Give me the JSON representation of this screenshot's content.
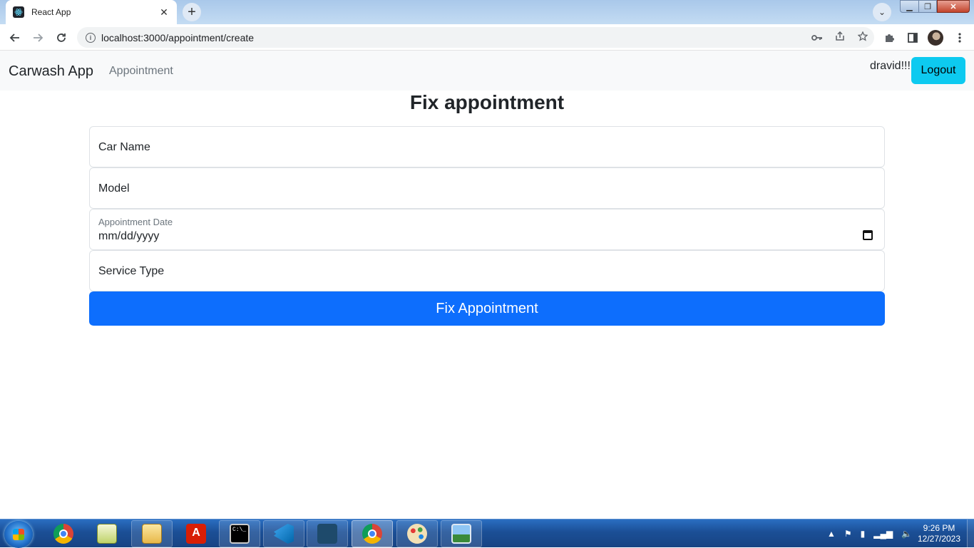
{
  "browser": {
    "tab_title": "React App",
    "tab_close": "✕",
    "new_tab": "+",
    "tab_search": "⌄",
    "url": "localhost:3000/appointment/create",
    "window_controls": {
      "minimize": "▁",
      "maximize": "❐",
      "close": "✕"
    }
  },
  "navbar": {
    "brand": "Carwash App",
    "link_appointment": "Appointment",
    "username": "dravid!!!",
    "logout_label": "Logout"
  },
  "form": {
    "title": "Fix appointment",
    "car_name_placeholder": "Car Name",
    "model_placeholder": "Model",
    "date_label": "Appointment Date",
    "date_value": "mm/dd/yyyy",
    "service_type_placeholder": "Service Type",
    "submit_label": "Fix Appointment"
  },
  "taskbar": {
    "apps": [
      "chrome",
      "notepad",
      "file-explorer",
      "acrobat",
      "command-prompt",
      "vscode",
      "mysql-workbench",
      "chrome",
      "paint",
      "photo-viewer"
    ],
    "clock_time": "9:26 PM",
    "clock_date": "12/27/2023"
  },
  "colors": {
    "primary": "#0d6efd",
    "info": "#0dcaf0",
    "navbar_bg": "#f8f9fa"
  }
}
